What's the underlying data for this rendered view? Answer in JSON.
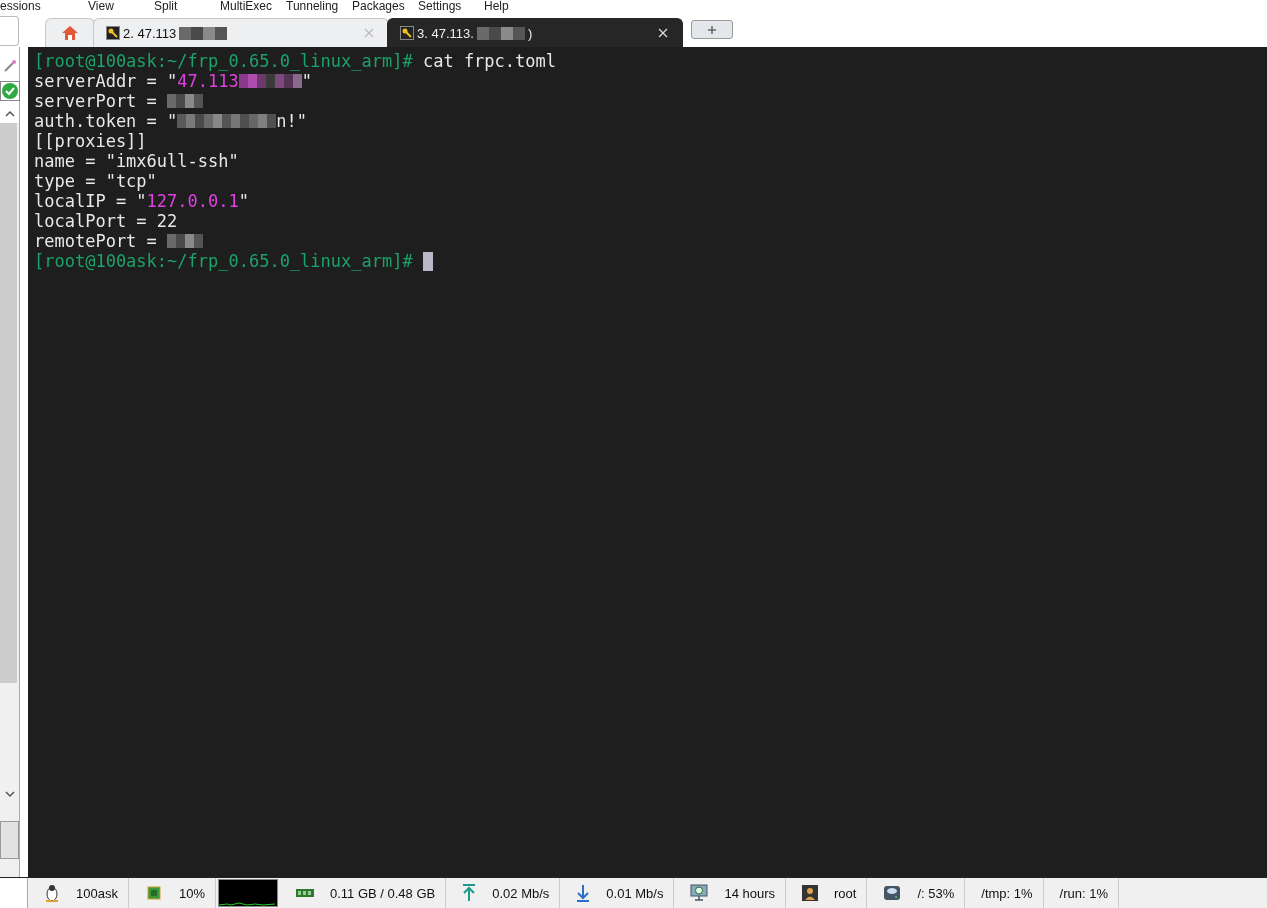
{
  "menu": [
    "essions",
    "View",
    "Split",
    "MultiExec",
    "Tunneling",
    "Packages",
    "Settings",
    "Help"
  ],
  "tabs": [
    {
      "kind": "home",
      "selected": false
    },
    {
      "kind": "session",
      "label": "2. 47.113",
      "selected": false
    },
    {
      "kind": "session",
      "label": "3. 47.113.",
      "label_end": ")",
      "selected": true
    },
    {
      "kind": "new"
    }
  ],
  "terminal": {
    "lines": [
      [
        {
          "kind": "prompt",
          "text": "[root@100ask:~/frp_0.65.0_linux_arm]#"
        },
        {
          "kind": "text",
          "text": " cat frpc.toml"
        }
      ],
      [
        {
          "kind": "text",
          "text": "serverAddr = \""
        },
        {
          "kind": "value",
          "text": "47.113"
        },
        {
          "kind": "blur-pink"
        },
        {
          "kind": "text",
          "text": "\""
        }
      ],
      [
        {
          "kind": "text",
          "text": "serverPort = "
        },
        {
          "kind": "blur-short"
        }
      ],
      [
        {
          "kind": "text",
          "text": "auth.token = \""
        },
        {
          "kind": "blur-long"
        },
        {
          "kind": "text",
          "text": "n!\""
        }
      ],
      [
        {
          "kind": "text",
          "text": "[[proxies]]"
        }
      ],
      [
        {
          "kind": "text",
          "text": "name = \"imx6ull-ssh\""
        }
      ],
      [
        {
          "kind": "text",
          "text": "type = \"tcp\""
        }
      ],
      [
        {
          "kind": "text",
          "text": "localIP = \""
        },
        {
          "kind": "value",
          "text": "127.0.0.1"
        },
        {
          "kind": "text",
          "text": "\""
        }
      ],
      [
        {
          "kind": "text",
          "text": "localPort = 22"
        }
      ],
      [
        {
          "kind": "text",
          "text": "remotePort = "
        },
        {
          "kind": "blur-short"
        }
      ],
      [
        {
          "kind": "prompt",
          "text": "[root@100ask:~/frp_0.65.0_linux_arm]#"
        },
        {
          "kind": "cursor"
        }
      ]
    ]
  },
  "status_bar": [
    {
      "kind": "linux",
      "text": "100ask"
    },
    {
      "kind": "cpu",
      "text": "10%"
    },
    {
      "kind": "graph"
    },
    {
      "kind": "ram",
      "text": "0.11 GB / 0.48 GB"
    },
    {
      "kind": "up",
      "text": "0.02 Mb/s"
    },
    {
      "kind": "down",
      "text": "0.01 Mb/s"
    },
    {
      "kind": "uptime",
      "text": "14 hours"
    },
    {
      "kind": "user",
      "text": "root"
    },
    {
      "kind": "disk",
      "text": "/: 53%"
    },
    {
      "kind": "plain",
      "text": "/tmp: 1%"
    },
    {
      "kind": "plain",
      "text": "/run: 1%"
    }
  ]
}
